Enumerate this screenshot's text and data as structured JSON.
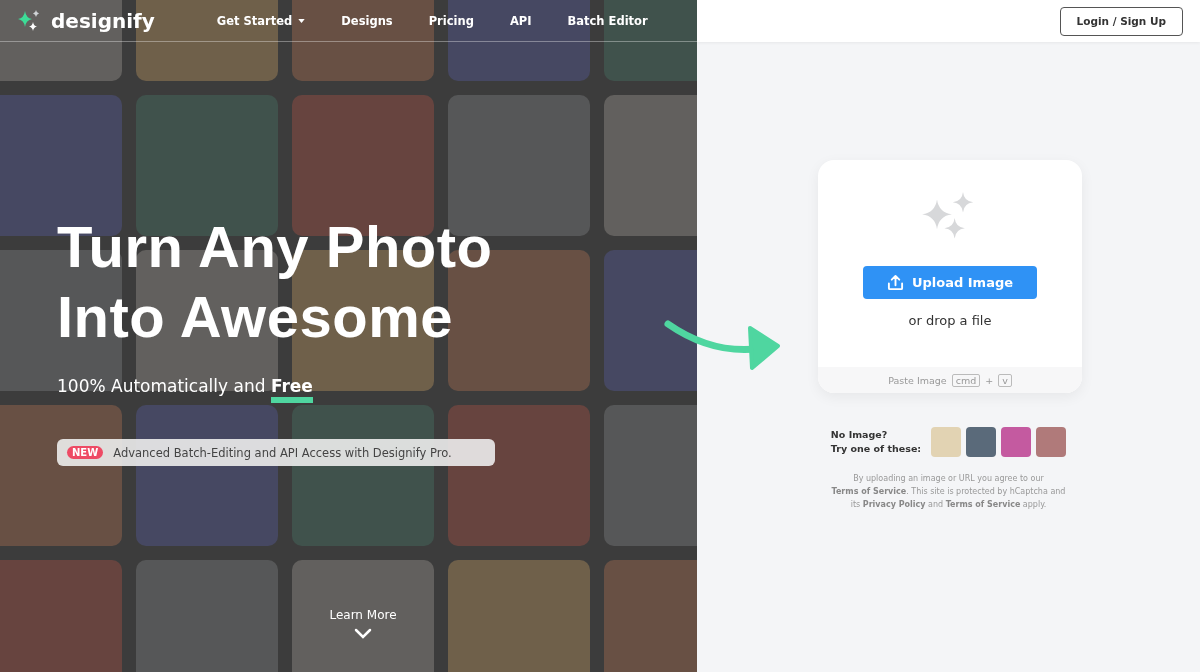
{
  "brand": {
    "name": "designify"
  },
  "nav": [
    {
      "label": "Get Started",
      "dropdown": true
    },
    {
      "label": "Designs",
      "dropdown": false
    },
    {
      "label": "Pricing",
      "dropdown": false
    },
    {
      "label": "API",
      "dropdown": false
    },
    {
      "label": "Batch Editor",
      "dropdown": false
    }
  ],
  "login_button": "Login / Sign Up",
  "hero": {
    "title_lines": [
      "Turn Any Photo",
      "Into Awesome"
    ],
    "subtitle": "100% Automatically and **Free**",
    "banner": {
      "badge": "NEW",
      "text": "Advanced Batch-Editing and API Access with Designify Pro."
    },
    "learn_more": "Learn More"
  },
  "upload": {
    "button": "Upload Image",
    "drop_text": "or drop a file",
    "paste_label": "Paste Image",
    "keys": [
      "cmd",
      "v"
    ],
    "key_joiner": "+"
  },
  "samples": {
    "prompt_lines": [
      "No Image?",
      "Try one of these:"
    ]
  },
  "legal": [
    {
      "text": "By uploading an image or URL you agree to our ",
      "link": false
    },
    {
      "text": "Terms of Service",
      "link": true
    },
    {
      "text": ". This site is protected by hCaptcha and its ",
      "link": false
    },
    {
      "text": "Privacy Policy",
      "link": true
    },
    {
      "text": " and ",
      "link": false
    },
    {
      "text": "Terms of Service",
      "link": true
    },
    {
      "text": " apply.",
      "link": false
    }
  ]
}
